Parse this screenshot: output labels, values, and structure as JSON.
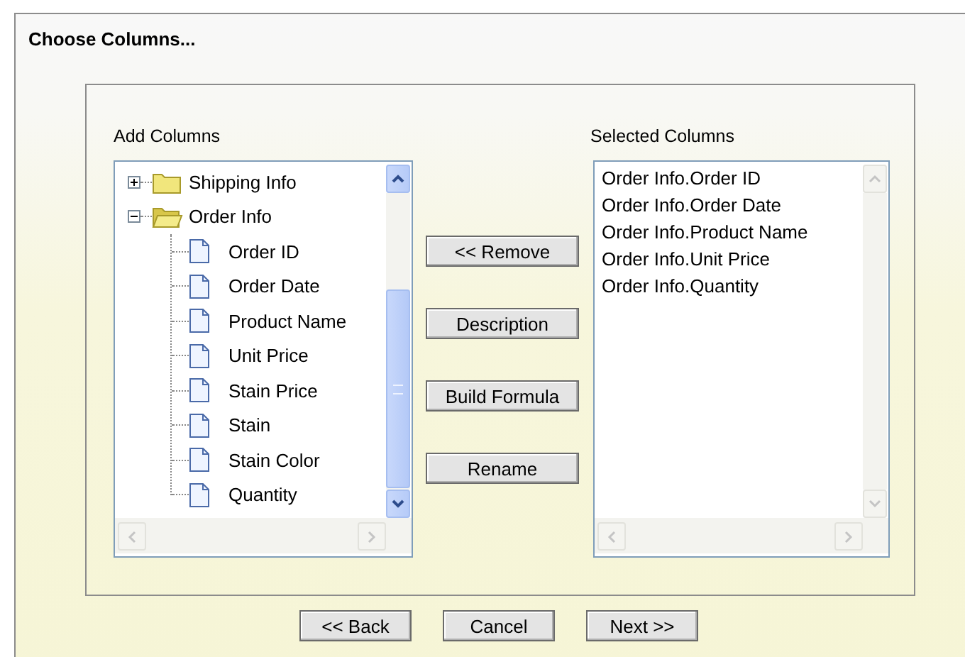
{
  "title": "Choose Columns...",
  "add_columns": {
    "label": "Add Columns",
    "tree": [
      {
        "label": "Shipping Info",
        "expanded": false
      },
      {
        "label": "Order Info",
        "expanded": true,
        "children": [
          {
            "label": "Order ID"
          },
          {
            "label": "Order Date"
          },
          {
            "label": "Product Name"
          },
          {
            "label": "Unit Price"
          },
          {
            "label": "Stain Price"
          },
          {
            "label": "Stain"
          },
          {
            "label": "Stain Color"
          },
          {
            "label": "Quantity"
          }
        ]
      }
    ]
  },
  "actions": [
    "<< Remove",
    "Description",
    "Build Formula",
    "Rename"
  ],
  "selected_columns": {
    "label": "Selected Columns",
    "items": [
      "Order Info.Order ID",
      "Order Info.Order Date",
      "Order Info.Product Name",
      "Order Info.Unit Price",
      "Order Info.Quantity"
    ]
  },
  "footer_buttons": [
    "<< Back",
    "Cancel",
    "Next >>"
  ]
}
